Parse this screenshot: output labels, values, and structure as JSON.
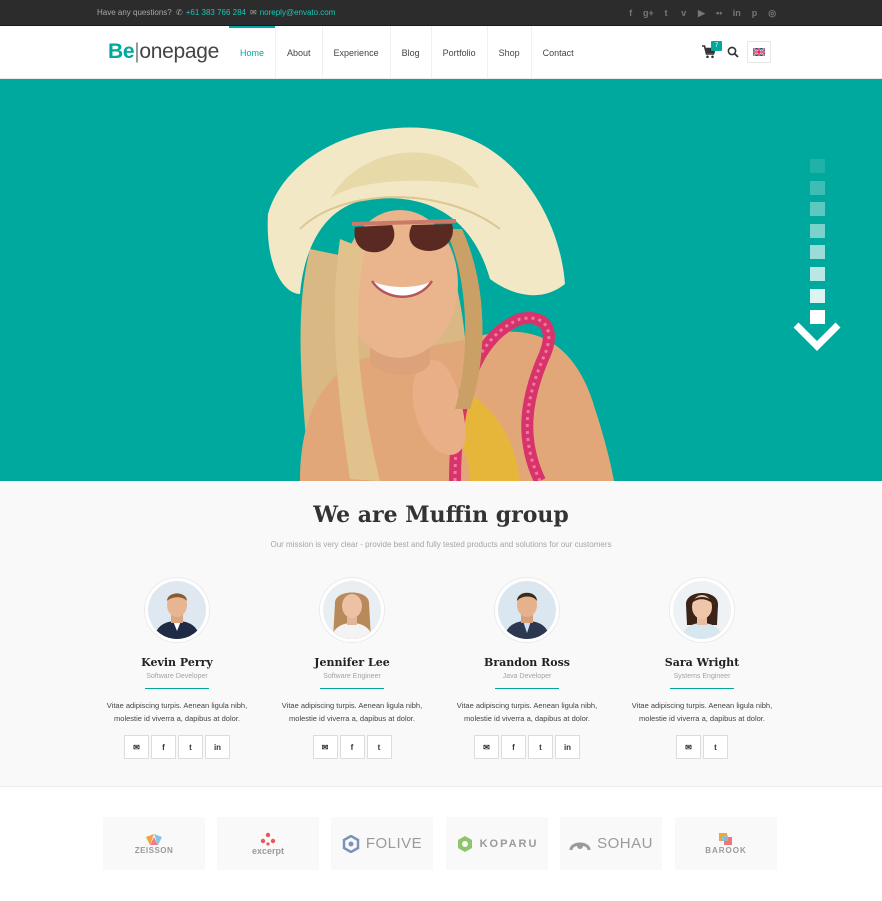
{
  "topbar": {
    "question": "Have any questions?",
    "phone": "+61 383 766 284",
    "email": "noreply@envato.com",
    "social_icons": [
      "facebook-icon",
      "google-plus-icon",
      "twitter-icon",
      "vimeo-icon",
      "youtube-icon",
      "flickr-icon",
      "linkedin-icon",
      "pinterest-icon",
      "dribbble-icon"
    ]
  },
  "header": {
    "logo_be": "Be",
    "logo_sep": "|",
    "logo_rest": "onepage",
    "nav": [
      "Home",
      "About",
      "Experience",
      "Blog",
      "Portfolio",
      "Shop",
      "Contact"
    ],
    "cart_count": "7",
    "accent": "#00a99d"
  },
  "hero": {
    "background": "#00a99d"
  },
  "about": {
    "title": "We are Muffin group",
    "subtitle": "Our mission is very clear - provide best and fully tested products and solutions for our customers",
    "members": [
      {
        "name": "Kevin Perry",
        "role": "Software Developer",
        "desc": "Vitae adipiscing turpis. Aenean ligula nibh, molestie id viverra a, dapibus at dolor.",
        "socials": [
          "email-icon",
          "facebook-icon",
          "twitter-icon",
          "linkedin-icon"
        ]
      },
      {
        "name": "Jennifer Lee",
        "role": "Software Engineer",
        "desc": "Vitae adipiscing turpis. Aenean ligula nibh, molestie id viverra a, dapibus at dolor.",
        "socials": [
          "email-icon",
          "facebook-icon",
          "twitter-icon"
        ]
      },
      {
        "name": "Brandon Ross",
        "role": "Java Developer",
        "desc": "Vitae adipiscing turpis. Aenean ligula nibh, molestie id viverra a, dapibus at dolor.",
        "socials": [
          "email-icon",
          "facebook-icon",
          "twitter-icon",
          "linkedin-icon"
        ]
      },
      {
        "name": "Sara Wright",
        "role": "Systems Engineer",
        "desc": "Vitae adipiscing turpis. Aenean ligula nibh, molestie id viverra a, dapibus at dolor.",
        "socials": [
          "email-icon",
          "twitter-icon"
        ]
      }
    ]
  },
  "clients": [
    "ZEISSON",
    "excerpt",
    "FOLIVE",
    "KOPARU",
    "SOHAU",
    "BAROOK"
  ]
}
